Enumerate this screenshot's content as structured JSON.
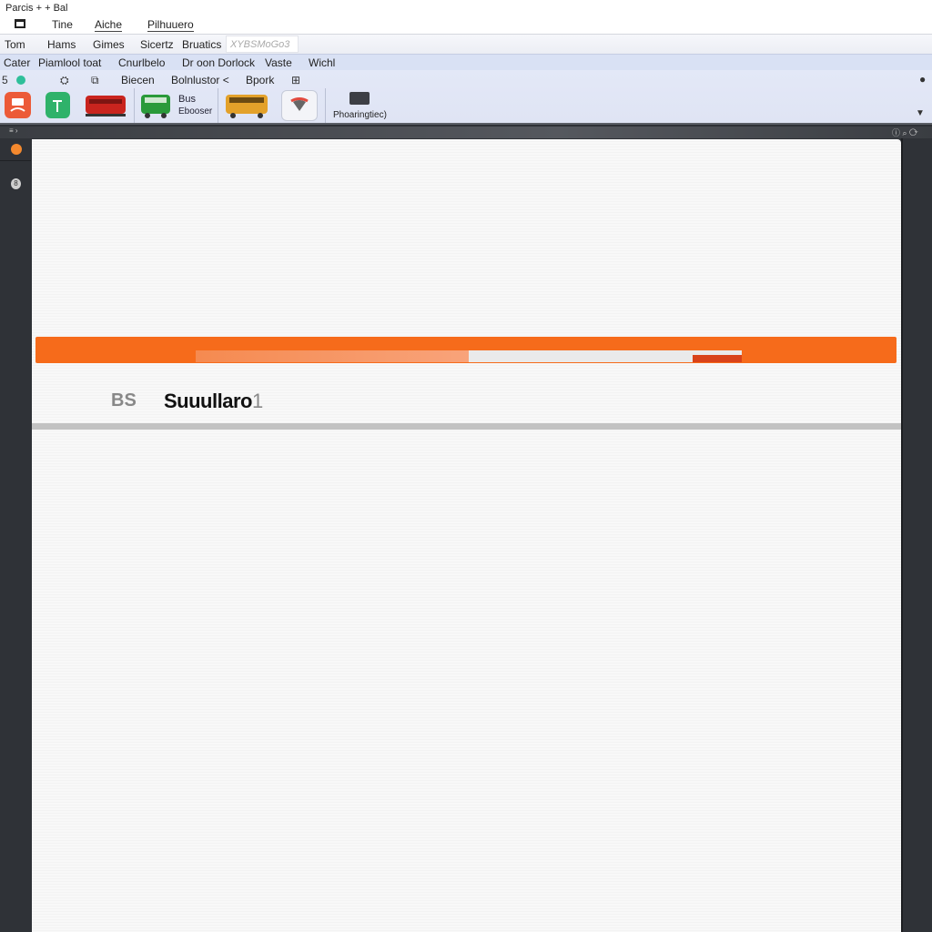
{
  "app": {
    "title": "Parcis + + Bal"
  },
  "menu_row1": [
    "Tine",
    "Aiche",
    "Pilhuuero"
  ],
  "menu_row2": {
    "items": [
      "Tom",
      "Hams",
      "Gimes",
      "Sicertz",
      "Bruatics"
    ],
    "search_placeholder": "XYBSMoGo3"
  },
  "menu_row3": [
    "Cater",
    "Piamlool toat",
    "Cnurlbelo",
    "Dr oon Dorlock",
    "Vaste",
    "Wichl"
  ],
  "ribbon": {
    "tabs": [
      "Biecen",
      "Bolnlustor <",
      "Bpork"
    ],
    "small_icons": [
      "page-number-5",
      "teal-drop-icon",
      "robot-icon",
      "puzzle-icon",
      "grid-icon"
    ],
    "buttons": [
      {
        "name": "orange-train-app",
        "color": "#ec5a38"
      },
      {
        "name": "green-signal-app",
        "color": "#2fb26a"
      },
      {
        "name": "red-train",
        "color": "#c9241e"
      },
      {
        "name": "green-bus",
        "color": "#2a9a3a",
        "label_line1": "Bus",
        "label_line2": "Ebooser"
      },
      {
        "name": "yellow-tram",
        "color": "#e3a12a"
      },
      {
        "name": "heart-marker",
        "color": "#e24a3e"
      }
    ],
    "preview_label": "Phoaringtiec)",
    "user_icon": "user-icon",
    "collapse_icon": "caret-down-icon"
  },
  "framebar": {
    "right_text": "ⓘ  ⌕ ⟳"
  },
  "sidebar": {
    "icons": [
      "orange-dot-icon",
      "pin-icon"
    ]
  },
  "document": {
    "progress": 0.5,
    "marker_range": [
      0.91,
      1.0
    ],
    "heading_prefix": "BS",
    "heading_title": "Suuullaro",
    "heading_number": "1"
  }
}
